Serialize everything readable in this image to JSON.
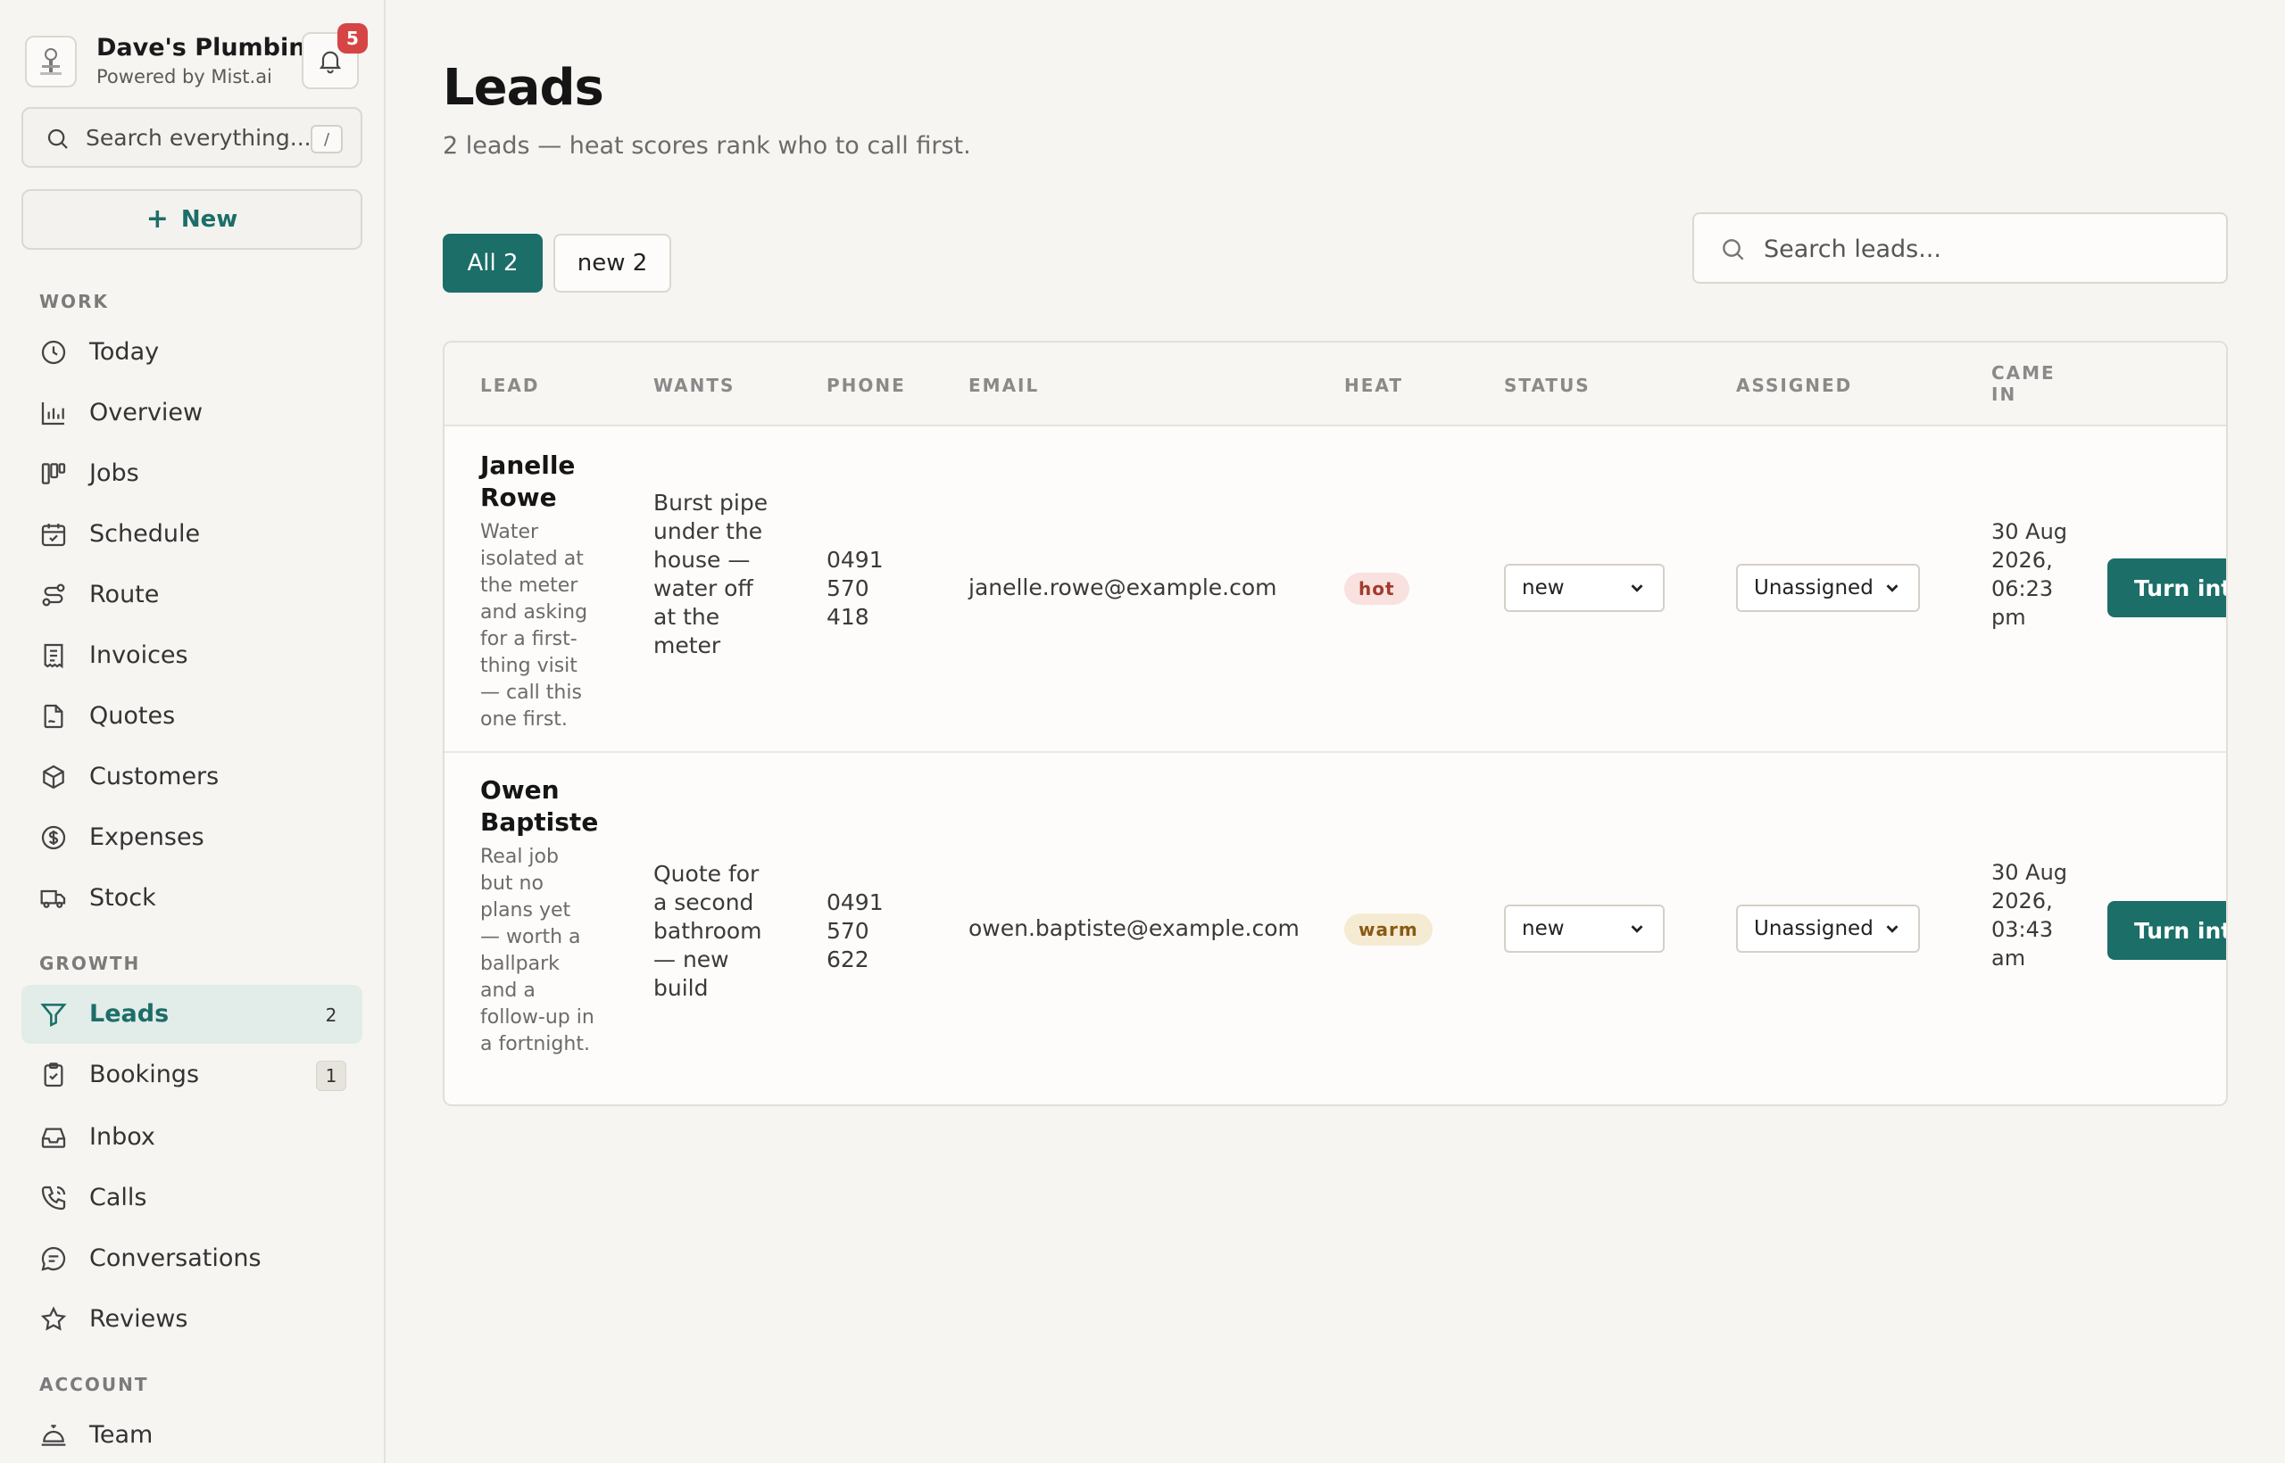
{
  "brand": {
    "name": "Dave's Plumbin...",
    "sub": "Powered by Mist.ai",
    "notifications": "5"
  },
  "sidebar": {
    "search_placeholder": "Search everything...",
    "search_shortcut": "/",
    "new_label": "New",
    "sections": {
      "work": "WORK",
      "growth": "GROWTH",
      "account": "ACCOUNT"
    },
    "items": [
      {
        "label": "Today",
        "icon": "clock-icon"
      },
      {
        "label": "Overview",
        "icon": "bar-chart-icon"
      },
      {
        "label": "Jobs",
        "icon": "kanban-icon"
      },
      {
        "label": "Schedule",
        "icon": "calendar-check-icon"
      },
      {
        "label": "Route",
        "icon": "route-icon"
      },
      {
        "label": "Invoices",
        "icon": "receipt-icon"
      },
      {
        "label": "Quotes",
        "icon": "file-signature-icon"
      },
      {
        "label": "Customers",
        "icon": "box-icon"
      },
      {
        "label": "Expenses",
        "icon": "dollar-circle-icon"
      },
      {
        "label": "Stock",
        "icon": "truck-icon"
      },
      {
        "label": "Leads",
        "icon": "filter-icon",
        "count": "2"
      },
      {
        "label": "Bookings",
        "icon": "clipboard-check-icon",
        "count": "1"
      },
      {
        "label": "Inbox",
        "icon": "inbox-icon"
      },
      {
        "label": "Calls",
        "icon": "phone-icon"
      },
      {
        "label": "Conversations",
        "icon": "chat-icon"
      },
      {
        "label": "Reviews",
        "icon": "star-icon"
      },
      {
        "label": "Team",
        "icon": "bell-service-icon"
      }
    ]
  },
  "main": {
    "title": "Leads",
    "subtitle": "2 leads — heat scores rank who to call first.",
    "tabs": [
      {
        "label": "All 2"
      },
      {
        "label": "new 2"
      }
    ],
    "search_placeholder": "Search leads..."
  },
  "table": {
    "headers": {
      "lead": "LEAD",
      "wants": "WANTS",
      "phone": "PHONE",
      "email": "EMAIL",
      "heat": "HEAT",
      "status": "STATUS",
      "assigned": "ASSIGNED",
      "came_in": "CAME IN"
    },
    "rows": [
      {
        "name": "Janelle Rowe",
        "note": "Water isolated at the meter and asking for a first-thing visit — call this one first.",
        "wants": "Burst pipe under the house — water off at the meter",
        "phone": "0491 570 418",
        "email": "janelle.rowe@example.com",
        "heat": "hot",
        "status": "new",
        "assigned": "Unassigned",
        "came_in": "30 Aug 2026, 06:23 pm",
        "action": "Turn into job"
      },
      {
        "name": "Owen Baptiste",
        "note": "Real job but no plans yet — worth a ballpark and a follow-up in a fortnight.",
        "wants": "Quote for a second bathroom — new build",
        "phone": "0491 570 622",
        "email": "owen.baptiste@example.com",
        "heat": "warm",
        "status": "new",
        "assigned": "Unassigned",
        "came_in": "30 Aug 2026, 03:43 am",
        "action": "Turn into job"
      }
    ]
  }
}
